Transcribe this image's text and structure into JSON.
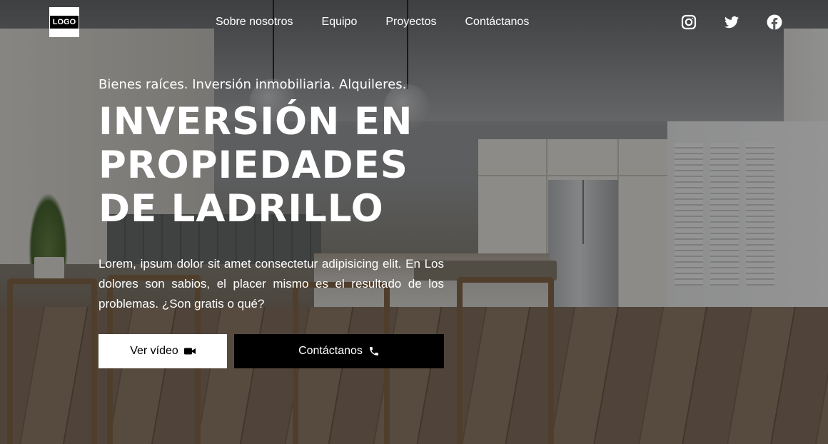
{
  "header": {
    "logo_text": "LOGO",
    "nav": [
      {
        "label": "Sobre nosotros",
        "icon": ""
      },
      {
        "label": "Equipo",
        "icon": ""
      },
      {
        "label": "Proyectos",
        "icon": ""
      },
      {
        "label": "Contáctanos",
        "icon": ""
      }
    ],
    "social": [
      {
        "name": "instagram",
        "icon": "instagram-icon"
      },
      {
        "name": "twitter",
        "icon": "twitter-icon"
      },
      {
        "name": "facebook",
        "icon": "facebook-icon"
      }
    ]
  },
  "hero": {
    "tagline": "Bienes raíces. Inversión inmobiliaria. Alquileres.",
    "title": "INVERSIÓN EN PROPIEDADES DE LADRILLO",
    "description": "Lorem, ipsum dolor sit amet consectetur adipisicing elit. En Los dolores son sabios, el placer mismo es el resultado de los problemas. ¿Son gratis o qué?",
    "buttons": {
      "video_label": "Ver vídeo",
      "video_icon": "video-camera-icon",
      "contact_label": "Contáctanos",
      "contact_icon": "phone-icon"
    }
  },
  "colors": {
    "overlay": "#000000",
    "button_light_bg": "#ffffff",
    "button_dark_bg": "#000000",
    "text": "#ffffff"
  }
}
